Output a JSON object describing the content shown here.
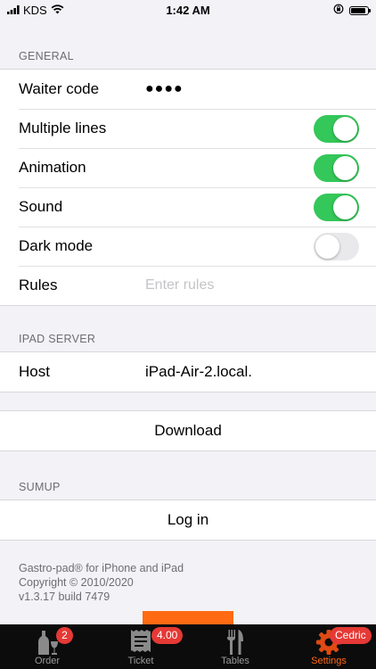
{
  "status": {
    "carrier": "KDS",
    "time": "1:42 AM",
    "battery_level": 0.9
  },
  "general": {
    "header": "GENERAL",
    "waiter_code": {
      "label": "Waiter code",
      "value": "●●●●"
    },
    "multiple_lines": {
      "label": "Multiple lines",
      "on": true
    },
    "animation": {
      "label": "Animation",
      "on": true
    },
    "sound": {
      "label": "Sound",
      "on": true
    },
    "dark_mode": {
      "label": "Dark mode",
      "on": false
    },
    "rules": {
      "label": "Rules",
      "placeholder": "Enter rules"
    }
  },
  "ipad_server": {
    "header": "IPAD SERVER",
    "host": {
      "label": "Host",
      "value": "iPad-Air-2.local."
    }
  },
  "download": {
    "label": "Download"
  },
  "sumup": {
    "header": "SUMUP",
    "login": "Log in"
  },
  "footer": {
    "line1": "Gastro-pad® for iPhone and iPad",
    "line2": "Copyright © 2010/2020",
    "line3": "v1.3.17 build 7479"
  },
  "tabs": [
    {
      "label": "Order",
      "badge": "2",
      "icon": "bottle-icon"
    },
    {
      "label": "Ticket",
      "badge": "4.00",
      "icon": "ticket-icon"
    },
    {
      "label": "Tables",
      "badge": "",
      "icon": "cutlery-icon"
    },
    {
      "label": "Settings",
      "badge": "Cedric",
      "icon": "gear-icon",
      "active": true
    }
  ],
  "colors": {
    "accent": "#ff6a13",
    "toggle_on": "#34c759",
    "badge": "#e53935"
  }
}
